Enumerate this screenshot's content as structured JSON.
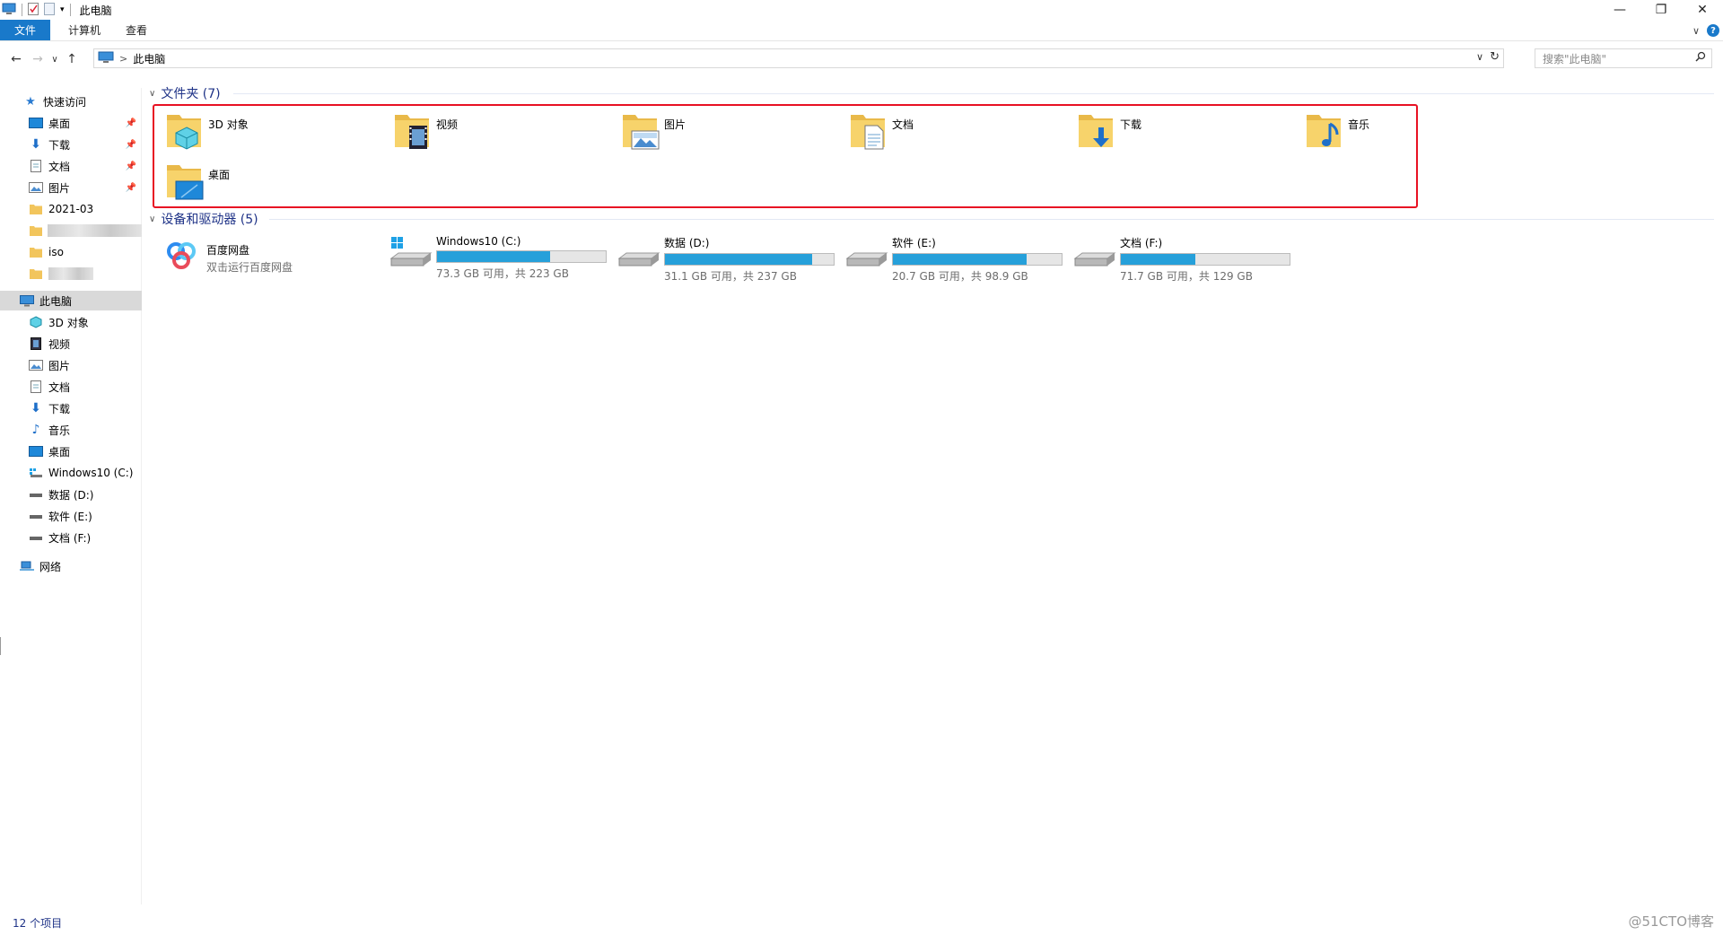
{
  "window": {
    "title": "此电脑",
    "minimize": "—",
    "restore": "❐",
    "close": "✕"
  },
  "ribbon": {
    "tabs": [
      {
        "label": "文件"
      },
      {
        "label": "计算机"
      },
      {
        "label": "查看"
      }
    ],
    "collapse": "∨",
    "help": "?"
  },
  "address": {
    "crumb": "此电脑",
    "separator": ">",
    "dropdown": "∨",
    "refresh": "↻"
  },
  "search": {
    "placeholder": "搜索\"此电脑\""
  },
  "sidebar": {
    "quick_access": "快速访问",
    "quick_items": [
      {
        "label": "桌面"
      },
      {
        "label": "下载"
      },
      {
        "label": "文档"
      },
      {
        "label": "图片"
      },
      {
        "label": "2021-03"
      },
      {
        "label": "iso"
      }
    ],
    "this_pc": "此电脑",
    "pc_items": [
      {
        "label": "3D 对象"
      },
      {
        "label": "视频"
      },
      {
        "label": "图片"
      },
      {
        "label": "文档"
      },
      {
        "label": "下载"
      },
      {
        "label": "音乐"
      },
      {
        "label": "桌面"
      },
      {
        "label": "Windows10 (C:)"
      },
      {
        "label": "数据 (D:)"
      },
      {
        "label": "软件 (E:)"
      },
      {
        "label": "文档 (F:)"
      }
    ],
    "network": "网络"
  },
  "content": {
    "folders_header": "文件夹 (7)",
    "folders": [
      {
        "label": "3D 对象"
      },
      {
        "label": "视频"
      },
      {
        "label": "图片"
      },
      {
        "label": "文档"
      },
      {
        "label": "下载"
      },
      {
        "label": "音乐"
      },
      {
        "label": "桌面"
      }
    ],
    "devices_header": "设备和驱动器 (5)",
    "baidu": {
      "name": "百度网盘",
      "sub": "双击运行百度网盘"
    },
    "drives": [
      {
        "name": "Windows10 (C:)",
        "free": "73.3 GB 可用，共 223 GB",
        "used_fraction": 0.67
      },
      {
        "name": "数据 (D:)",
        "free": "31.1 GB 可用，共 237 GB",
        "used_fraction": 0.87
      },
      {
        "name": "软件 (E:)",
        "free": "20.7 GB 可用，共 98.9 GB",
        "used_fraction": 0.79
      },
      {
        "name": "文档 (F:)",
        "free": "71.7 GB 可用，共 129 GB",
        "used_fraction": 0.44
      }
    ]
  },
  "status": {
    "items": "12 个项目"
  },
  "watermark": "@51CTO博客",
  "colors": {
    "accent": "#1979ca",
    "folder": "#f2c55c",
    "drive_fill": "#26a0da",
    "highlight": "#e81123",
    "group_header": "#1e3287"
  }
}
